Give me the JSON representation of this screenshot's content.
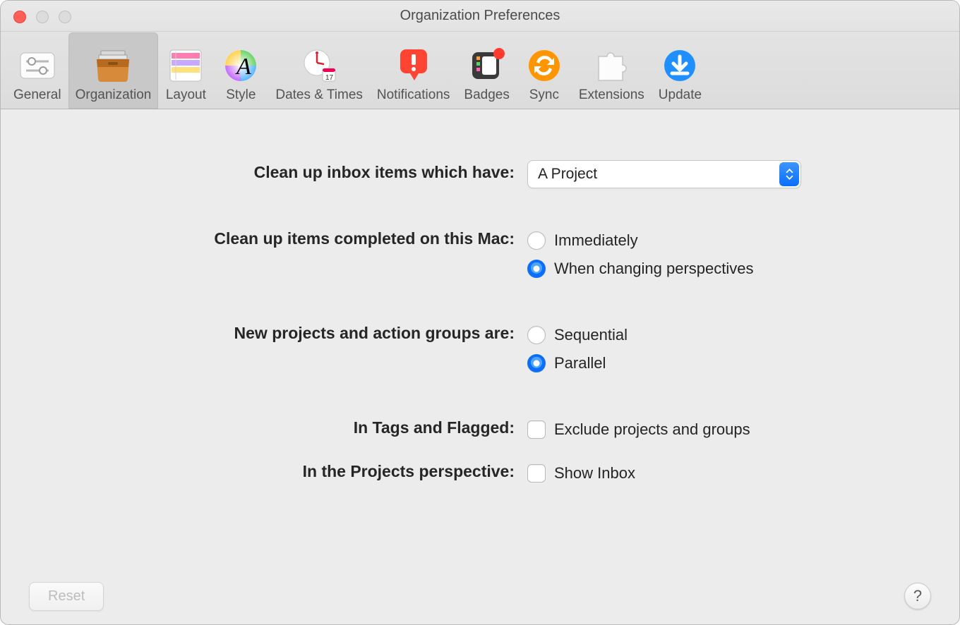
{
  "window": {
    "title": "Organization Preferences"
  },
  "toolbar": {
    "tabs": [
      {
        "label": "General"
      },
      {
        "label": "Organization"
      },
      {
        "label": "Layout"
      },
      {
        "label": "Style"
      },
      {
        "label": "Dates & Times"
      },
      {
        "label": "Notifications"
      },
      {
        "label": "Badges"
      },
      {
        "label": "Sync"
      },
      {
        "label": "Extensions"
      },
      {
        "label": "Update"
      }
    ],
    "active_index": 1
  },
  "form": {
    "cleanup_inbox": {
      "label": "Clean up inbox items which have:",
      "value": "A Project"
    },
    "cleanup_completed": {
      "label": "Clean up items completed on this Mac:",
      "options": [
        "Immediately",
        "When changing perspectives"
      ],
      "selected_index": 1
    },
    "new_projects": {
      "label": "New projects and action groups are:",
      "options": [
        "Sequential",
        "Parallel"
      ],
      "selected_index": 1
    },
    "tags_flagged": {
      "label": "In Tags and Flagged:",
      "option": "Exclude projects and groups",
      "checked": false
    },
    "projects_perspective": {
      "label": "In the Projects perspective:",
      "option": "Show Inbox",
      "checked": false
    }
  },
  "footer": {
    "reset": "Reset",
    "help": "?"
  }
}
